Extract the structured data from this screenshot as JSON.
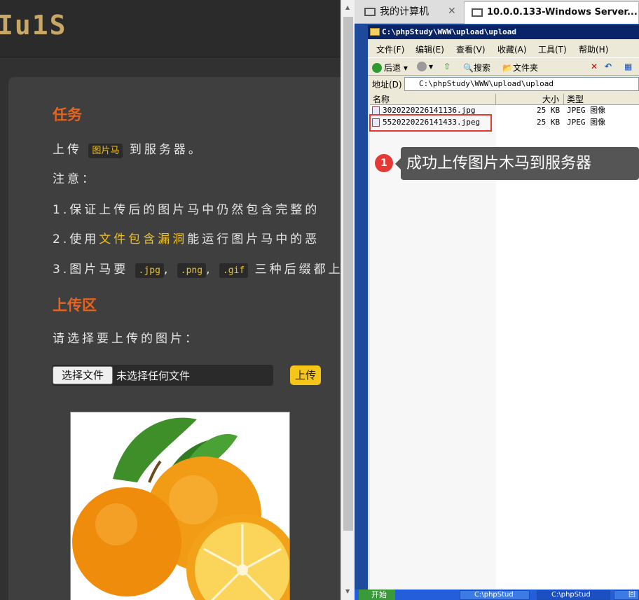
{
  "web": {
    "logo": "Iu1S",
    "task_heading": "任务",
    "task_prefix": "上传",
    "task_code": "图片马",
    "task_suffix": "到服务器。",
    "notice": "注意：",
    "note1": "1.保证上传后的图片马中仍然包含完整的",
    "note2_prefix": "2.使用",
    "note2_highlight": "文件包含漏洞",
    "note2_suffix": "能运行图片马中的恶",
    "note3_prefix": "3.图片马要",
    "ext_jpg": ".jpg",
    "ext_png": ".png",
    "ext_gif": ".gif",
    "note3_suffix": "三种后缀都上",
    "comma": ",",
    "upload_heading": "上传区",
    "choose_prompt": "请选择要上传的图片：",
    "choose_button": "选择文件",
    "file_status": "未选择任何文件",
    "upload_button": "上传"
  },
  "vm": {
    "tab1": "我的计算机",
    "tab2": "10.0.0.133-Windows Server...",
    "explorer_title": "C:\\phpStudy\\WWW\\upload\\upload",
    "menu": [
      "文件(F)",
      "编辑(E)",
      "查看(V)",
      "收藏(A)",
      "工具(T)",
      "帮助(H)"
    ],
    "toolbar": {
      "back": "后退",
      "search": "搜索",
      "folders": "文件夹"
    },
    "address_label": "地址(D)",
    "address_value": "C:\\phpStudy\\WWW\\upload\\upload",
    "columns": {
      "name": "名称",
      "size": "大小",
      "type": "类型"
    },
    "files": [
      {
        "name": "3020220226141136.jpg",
        "size": "25 KB",
        "type": "JPEG 图像"
      },
      {
        "name": "5520220226141433.jpeg",
        "size": "25 KB",
        "type": "JPEG 图像"
      }
    ],
    "taskbar": {
      "start": "开始",
      "item1": "C:\\phpStud",
      "item2": "C:\\phpStud",
      "item3": "回"
    }
  },
  "annotation": {
    "badge": "1",
    "text": "成功上传图片木马到服务器"
  },
  "colors": {
    "accent_orange": "#e8631c",
    "code_yellow": "#f0c020",
    "callout_bg": "#555555",
    "highlight_red": "#e53935"
  }
}
